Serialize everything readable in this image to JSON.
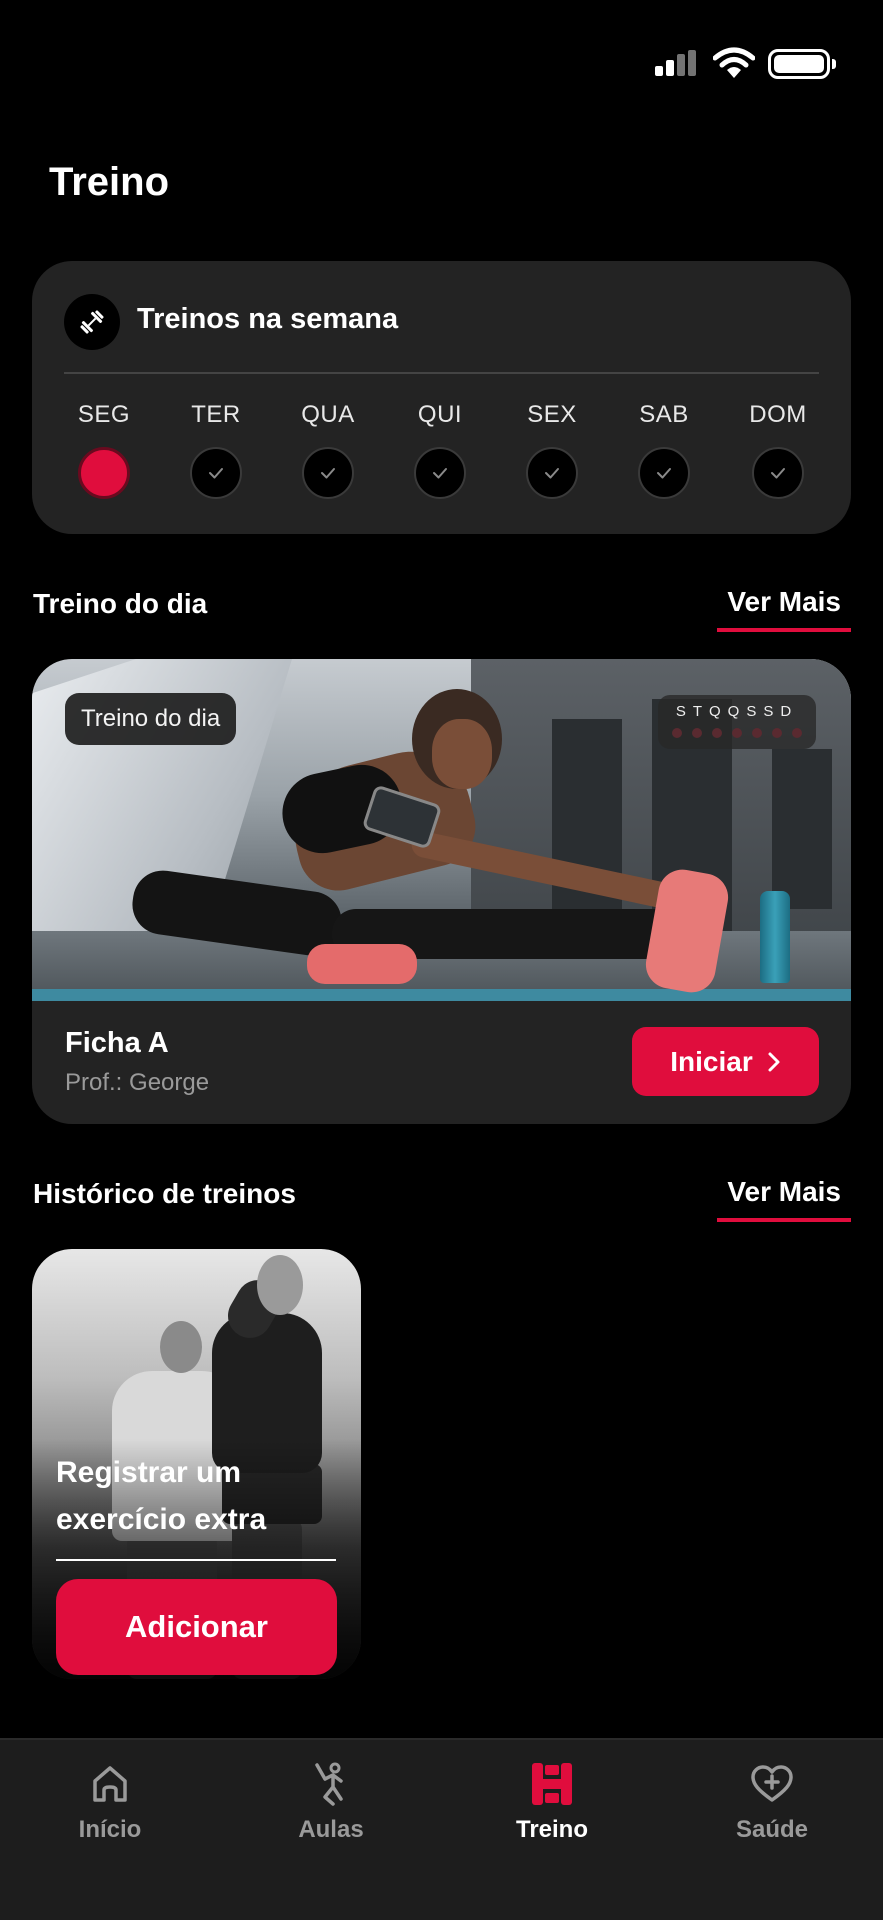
{
  "page": {
    "title": "Treino"
  },
  "week": {
    "title": "Treinos na semana",
    "days": [
      {
        "label": "SEG",
        "state": "today"
      },
      {
        "label": "TER",
        "state": "check"
      },
      {
        "label": "QUA",
        "state": "check"
      },
      {
        "label": "QUI",
        "state": "check"
      },
      {
        "label": "SEX",
        "state": "check"
      },
      {
        "label": "SAB",
        "state": "check"
      },
      {
        "label": "DOM",
        "state": "check"
      }
    ]
  },
  "daily": {
    "section_title": "Treino do dia",
    "see_more": "Ver Mais",
    "tag": "Treino do dia",
    "mini_week": "STQQSSD",
    "workout_name": "Ficha A",
    "professor": "Prof.: George",
    "start_label": "Iniciar"
  },
  "history": {
    "section_title": "Histórico de treinos",
    "see_more": "Ver Mais",
    "card_text": "Registrar um exercício extra",
    "add_label": "Adicionar"
  },
  "nav": {
    "items": [
      {
        "label": "Início",
        "icon": "home-icon"
      },
      {
        "label": "Aulas",
        "icon": "person-stretch-icon"
      },
      {
        "label": "Treino",
        "icon": "dumbbell-grid-icon",
        "active": true
      },
      {
        "label": "Saúde",
        "icon": "heart-plus-icon"
      }
    ]
  },
  "colors": {
    "accent": "#e00d3d",
    "card": "#232323",
    "background": "#000000"
  }
}
